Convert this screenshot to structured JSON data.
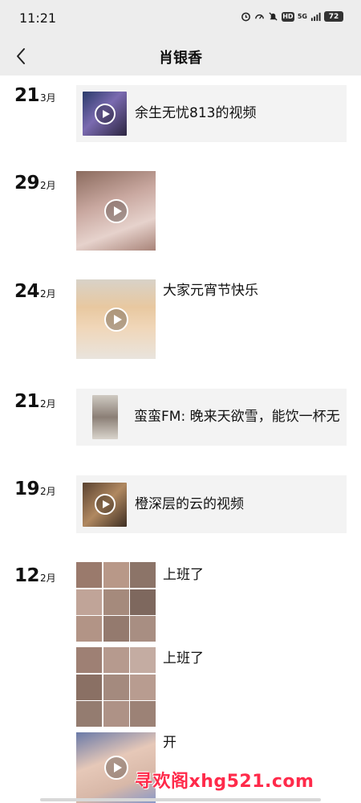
{
  "status_bar": {
    "time": "11:21",
    "network": "5G",
    "hd": "HD",
    "battery": "72",
    "icons": [
      "alarm-icon",
      "speed-icon",
      "mute-icon",
      "hd-icon",
      "signal-icon",
      "battery-icon"
    ]
  },
  "nav": {
    "back_icon": "chevron-left-icon",
    "title": "肖银香"
  },
  "posts": [
    {
      "day": "21",
      "month": "3月",
      "type": "shared-video",
      "text": "余生无忧813的视频"
    },
    {
      "day": "29",
      "month": "2月",
      "type": "video",
      "text": ""
    },
    {
      "day": "24",
      "month": "2月",
      "type": "video",
      "text": "大家元宵节快乐"
    },
    {
      "day": "21",
      "month": "2月",
      "type": "shared-music",
      "text": "蛮蛮FM: 晚来天欲雪，能饮一杯无"
    },
    {
      "day": "19",
      "month": "2月",
      "type": "shared-video",
      "text": "橙深层的云的视频"
    },
    {
      "day": "12",
      "month": "2月",
      "type": "photo-group",
      "entries": [
        {
          "text": "上班了",
          "image_count": 9
        },
        {
          "text": "上班了",
          "image_count": 9
        },
        {
          "text": "开",
          "media": "video"
        }
      ]
    }
  ],
  "watermark": "寻欢阁xhg521.com",
  "colors": {
    "header_bg": "#ededed",
    "card_bg": "#f3f3f3",
    "watermark": "#ff2a4a"
  }
}
